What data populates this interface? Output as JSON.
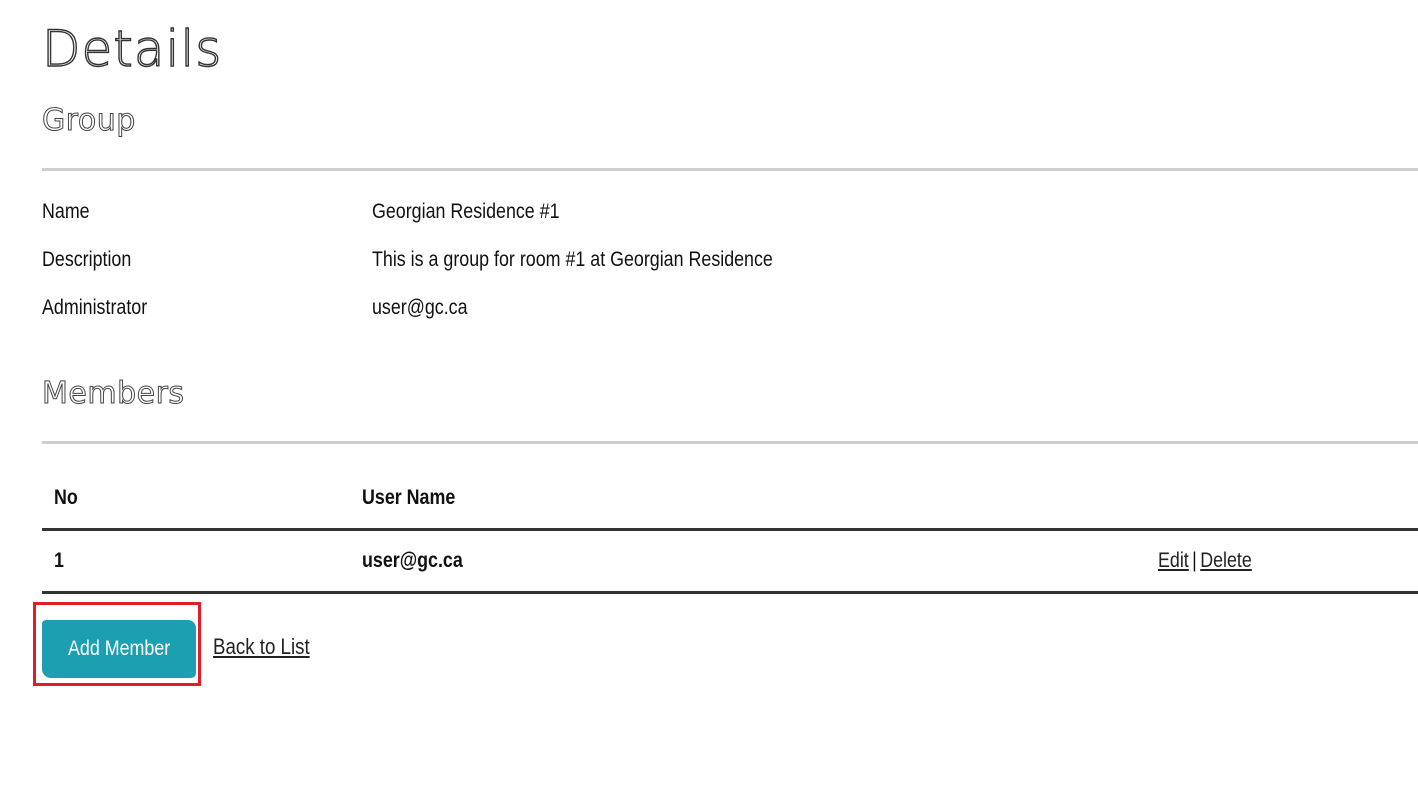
{
  "page": {
    "title": "Details"
  },
  "group": {
    "heading": "Group",
    "fields": [
      {
        "label": "Name",
        "value": "Georgian Residence #1"
      },
      {
        "label": "Description",
        "value": "This is a group for room #1 at Georgian Residence"
      },
      {
        "label": "Administrator",
        "value": "user@gc.ca"
      }
    ]
  },
  "members": {
    "heading": "Members",
    "columns": [
      "No",
      "User Name"
    ],
    "rows": [
      {
        "no": "1",
        "user_name": "user@gc.ca",
        "edit_label": "Edit",
        "separator": "|",
        "delete_label": "Delete"
      }
    ]
  },
  "actions": {
    "add_member_label": "Add Member",
    "back_to_list_label": "Back to List"
  },
  "colors": {
    "primary_button": "#1b9fb1",
    "highlight": "#e11d2a",
    "divider": "#cfcfcf",
    "table_border": "#333333"
  }
}
